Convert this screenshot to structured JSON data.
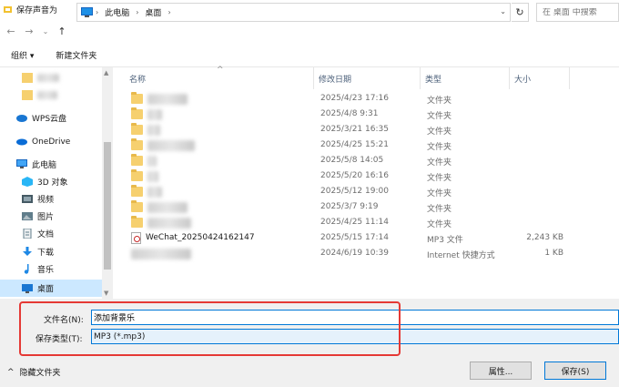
{
  "window": {
    "title": "保存声音为"
  },
  "address": {
    "crumbs": [
      "此电脑",
      "桌面"
    ]
  },
  "search": {
    "placeholder": "在 桌面 中搜索"
  },
  "toolbar": {
    "organize": "组织 ▾",
    "new_folder": "新建文件夹"
  },
  "nav": {
    "items": [
      {
        "label": "WPS云盘",
        "icon": "cloud-icon"
      },
      {
        "label": "OneDrive",
        "icon": "onedrive-icon"
      },
      {
        "label": "此电脑",
        "icon": "computer-icon"
      },
      {
        "label": "3D 对象",
        "icon": "cube-icon"
      },
      {
        "label": "视频",
        "icon": "video-icon"
      },
      {
        "label": "图片",
        "icon": "picture-icon"
      },
      {
        "label": "文档",
        "icon": "document-icon"
      },
      {
        "label": "下载",
        "icon": "download-icon"
      },
      {
        "label": "音乐",
        "icon": "music-icon"
      },
      {
        "label": "桌面",
        "icon": "desktop-icon",
        "selected": true
      }
    ]
  },
  "columns": {
    "name": "名称",
    "date": "修改日期",
    "type": "类型",
    "size": "大小"
  },
  "files": [
    {
      "date": "2025/4/23 17:16",
      "type": "文件夹",
      "size": ""
    },
    {
      "date": "2025/4/8 9:31",
      "type": "文件夹",
      "size": ""
    },
    {
      "date": "2025/3/21 16:35",
      "type": "文件夹",
      "size": ""
    },
    {
      "date": "2025/4/25 15:21",
      "type": "文件夹",
      "size": ""
    },
    {
      "date": "2025/5/8 14:05",
      "type": "文件夹",
      "size": ""
    },
    {
      "date": "2025/5/20 16:16",
      "type": "文件夹",
      "size": ""
    },
    {
      "date": "2025/5/12 19:00",
      "type": "文件夹",
      "size": ""
    },
    {
      "date": "2025/3/7 9:19",
      "type": "文件夹",
      "size": ""
    },
    {
      "date": "2025/4/25 11:14",
      "type": "文件夹",
      "size": ""
    },
    {
      "name": "WeChat_20250424162147",
      "date": "2025/5/15 17:14",
      "type": "MP3 文件",
      "size": "2,243 KB"
    },
    {
      "date": "2024/6/19 10:39",
      "type": "Internet 快捷方式",
      "size": "1 KB"
    }
  ],
  "form": {
    "filename_label": "文件名(N):",
    "filename_value": "添加背景乐",
    "filetype_label": "保存类型(T):",
    "filetype_value": "MP3 (*.mp3)"
  },
  "footer": {
    "hide_folders": "隐藏文件夹",
    "properties": "属性...",
    "save": "保存(S)"
  },
  "colors": {
    "accent": "#0078d7",
    "highlight": "#e53935",
    "selected": "#cce8ff"
  }
}
